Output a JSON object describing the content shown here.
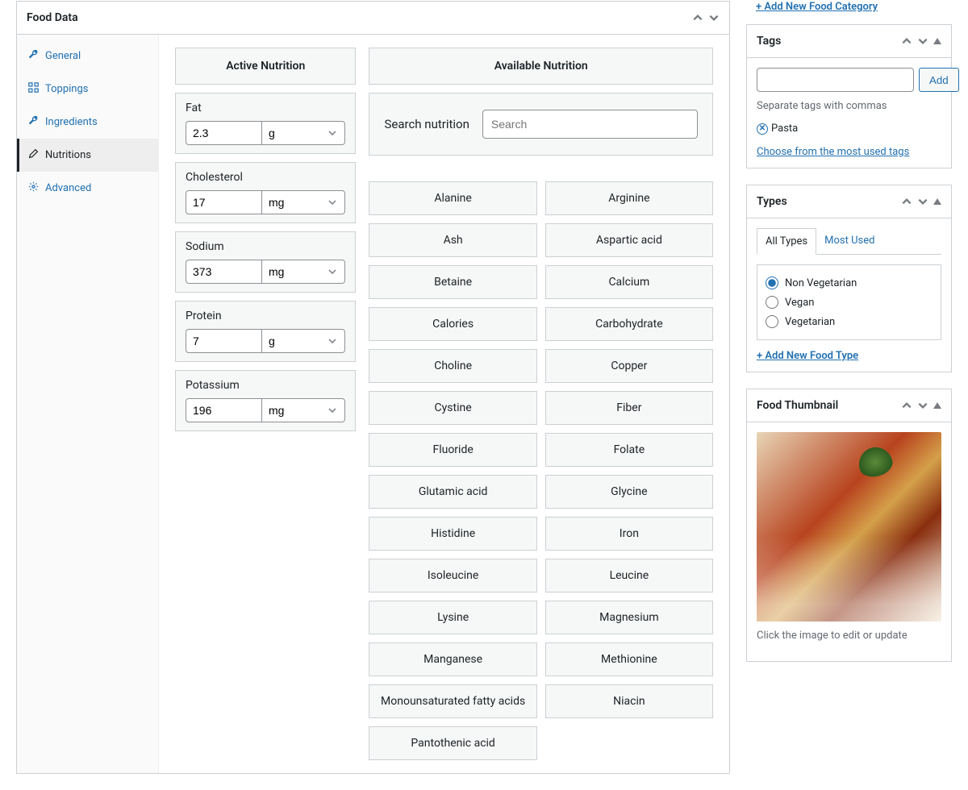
{
  "food_data": {
    "title": "Food Data",
    "sidebar": [
      {
        "label": "General",
        "icon": "wrench"
      },
      {
        "label": "Toppings",
        "icon": "grid"
      },
      {
        "label": "Ingredients",
        "icon": "wrench"
      },
      {
        "label": "Nutritions",
        "icon": "pencil",
        "active": true
      },
      {
        "label": "Advanced",
        "icon": "gear"
      }
    ],
    "active_nutrition": {
      "title": "Active Nutrition",
      "rows": [
        {
          "label": "Fat",
          "value": "2.3",
          "unit": "g"
        },
        {
          "label": "Cholesterol",
          "value": "17",
          "unit": "mg"
        },
        {
          "label": "Sodium",
          "value": "373",
          "unit": "mg"
        },
        {
          "label": "Protein",
          "value": "7",
          "unit": "g"
        },
        {
          "label": "Potassium",
          "value": "196",
          "unit": "mg"
        }
      ]
    },
    "available_nutrition": {
      "title": "Available Nutrition",
      "search_label": "Search nutrition",
      "search_placeholder": "Search",
      "items": [
        "Alanine",
        "Arginine",
        "Ash",
        "Aspartic acid",
        "Betaine",
        "Calcium",
        "Calories",
        "Carbohydrate",
        "Choline",
        "Copper",
        "Cystine",
        "Fiber",
        "Fluoride",
        "Folate",
        "Glutamic acid",
        "Glycine",
        "Histidine",
        "Iron",
        "Isoleucine",
        "Leucine",
        "Lysine",
        "Magnesium",
        "Manganese",
        "Methionine",
        "Monounsaturated fatty acids",
        "Niacin",
        "Pantothenic acid"
      ]
    }
  },
  "categories": {
    "add_link": "+ Add New Food Category"
  },
  "tags": {
    "title": "Tags",
    "add_btn": "Add",
    "helper": "Separate tags with commas",
    "chips": [
      "Pasta"
    ],
    "choose_link": "Choose from the most used tags"
  },
  "types": {
    "title": "Types",
    "tabs": [
      "All Types",
      "Most Used"
    ],
    "active_tab": 0,
    "options": [
      "Non Vegetarian",
      "Vegan",
      "Vegetarian"
    ],
    "selected": "Non Vegetarian",
    "add_link": "+ Add New Food Type"
  },
  "thumbnail": {
    "title": "Food Thumbnail",
    "helper": "Click the image to edit or update"
  }
}
